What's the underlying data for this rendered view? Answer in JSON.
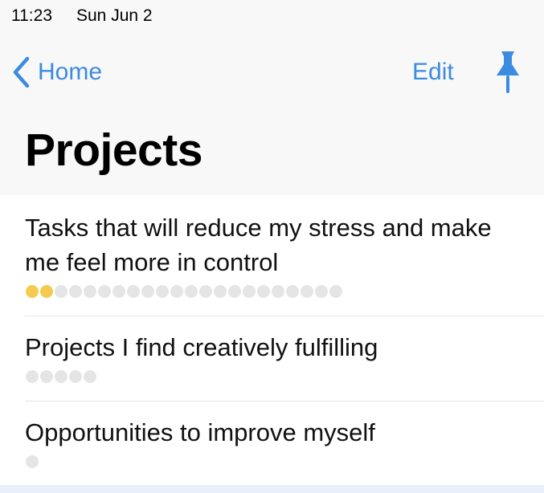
{
  "status_bar": {
    "time": "11:23",
    "date": "Sun Jun 2"
  },
  "nav": {
    "back_label": "Home",
    "back_icon": "chevron-left-icon",
    "edit_label": "Edit",
    "pin_icon": "pushpin-icon",
    "accent_color": "#3b8be0"
  },
  "page": {
    "title": "Projects"
  },
  "progress_colors": {
    "filled": "#f4cb4f",
    "empty": "#e5e5e5"
  },
  "projects": [
    {
      "title": "Tasks that will reduce my stress and make me feel more in control",
      "total_tasks": 22,
      "completed_tasks": 2
    },
    {
      "title": "Projects I find creatively fulfilling",
      "total_tasks": 5,
      "completed_tasks": 0
    },
    {
      "title": "Opportunities to improve myself",
      "total_tasks": 1,
      "completed_tasks": 0
    }
  ]
}
